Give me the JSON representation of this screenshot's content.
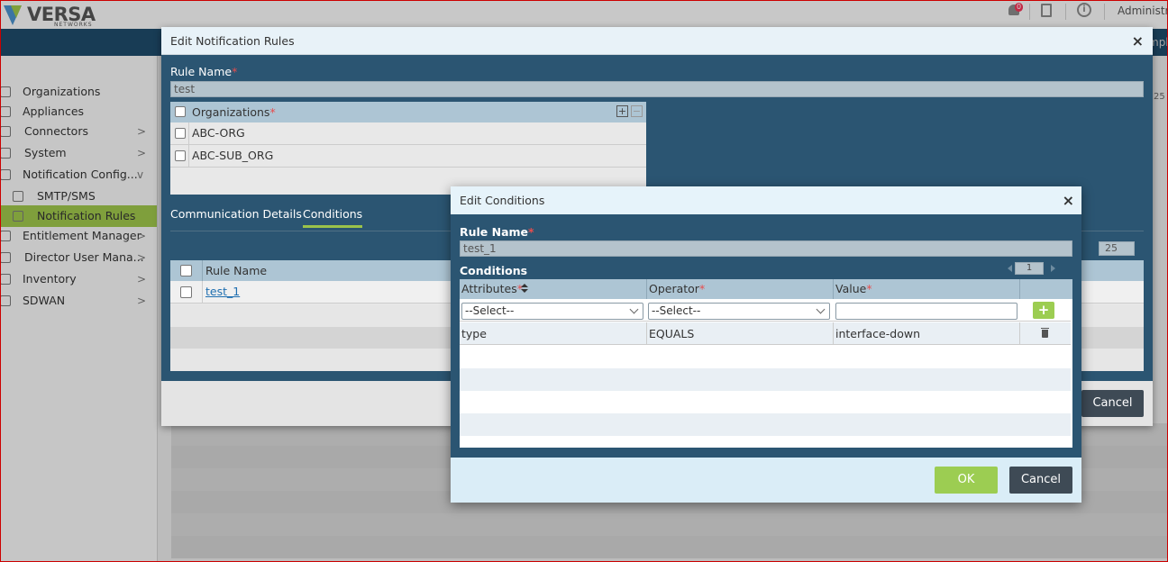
{
  "app": {
    "brand": "VERSA",
    "brand_sub": "NETWORKS",
    "notifications_count": "0",
    "user": "Administrator",
    "subbar_right": "mpl",
    "bg_pager": "25"
  },
  "sidebar": {
    "items": [
      {
        "label": "Organizations",
        "icon": "org-icon"
      },
      {
        "label": "Appliances",
        "icon": "appliance-icon"
      },
      {
        "label": "Connectors",
        "icon": "connector-icon"
      },
      {
        "label": "System",
        "icon": "system-icon"
      },
      {
        "label": "Notification Config...",
        "icon": "notification-icon"
      },
      {
        "label": "SMTP/SMS",
        "icon": "smtp-icon"
      },
      {
        "label": "Notification Rules",
        "icon": "rules-icon"
      },
      {
        "label": "Entitlement Manager",
        "icon": "entitlement-icon"
      },
      {
        "label": "Director User Mana...",
        "icon": "users-icon"
      },
      {
        "label": "Inventory",
        "icon": "inventory-icon"
      },
      {
        "label": "SDWAN",
        "icon": "sdwan-icon"
      }
    ]
  },
  "notification_modal": {
    "title": "Edit Notification Rules",
    "close": "×",
    "rule_name_label": "Rule Name",
    "rule_name_value": "test",
    "orgs_header": "Organizations",
    "orgs": [
      "ABC-ORG",
      "ABC-SUB_ORG"
    ],
    "tabs": [
      "Communication Details",
      "Conditions"
    ],
    "rules_header": "Rule Name",
    "rules": [
      "test_1"
    ],
    "pager": "25",
    "cancel": "Cancel"
  },
  "conditions_modal": {
    "title": "Edit Conditions",
    "close": "×",
    "rule_name_label": "Rule Name",
    "rule_name_value": "test_1",
    "conditions_label": "Conditions",
    "page": "1",
    "columns": {
      "attributes": "Attributes",
      "operator": "Operator",
      "value": "Value"
    },
    "new_row": {
      "attribute_select": "--Select--",
      "operator_select": "--Select--",
      "value": ""
    },
    "rows": [
      {
        "attribute": "type",
        "operator": "EQUALS",
        "value": "interface-down"
      }
    ],
    "ok": "OK",
    "cancel": "Cancel"
  },
  "colors": {
    "accent_green": "#9ccd52",
    "header_blue": "#2b5572",
    "required_red": "#e84d4d"
  }
}
